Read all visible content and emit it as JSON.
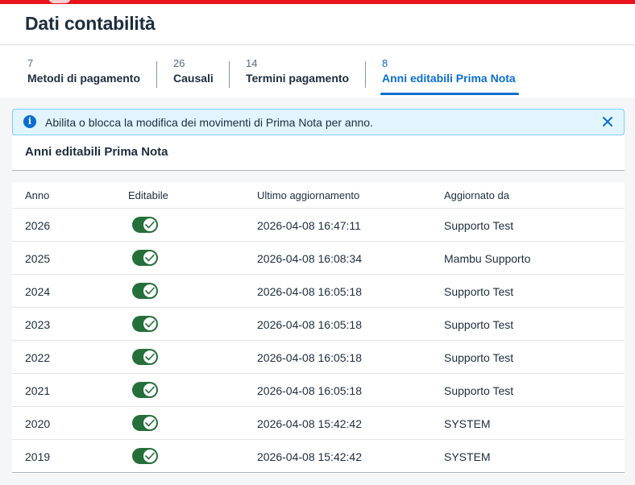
{
  "page": {
    "title": "Dati contabilità"
  },
  "tabs": [
    {
      "count": "7",
      "label": "Metodi di pagamento",
      "active": false
    },
    {
      "count": "26",
      "label": "Causali",
      "active": false
    },
    {
      "count": "14",
      "label": "Termini pagamento",
      "active": false
    },
    {
      "count": "8",
      "label": "Anni editabili Prima Nota",
      "active": true
    }
  ],
  "info_strip": {
    "text": "Abilita o blocca la modifica dei movimenti di Prima Nota per anno.",
    "icon": "info-icon"
  },
  "panel": {
    "title": "Anni editabili Prima Nota"
  },
  "table": {
    "headers": {
      "anno": "Anno",
      "editabile": "Editabile",
      "aggiornamento": "Ultimo aggiornamento",
      "aggiornato_da": "Aggiornato da"
    },
    "rows": [
      {
        "anno": "2026",
        "editable": true,
        "updated": "2026-04-08 16:47:11",
        "by": "Supporto Test"
      },
      {
        "anno": "2025",
        "editable": true,
        "updated": "2026-04-08 16:08:34",
        "by": "Mambu Supporto"
      },
      {
        "anno": "2024",
        "editable": true,
        "updated": "2026-04-08 16:05:18",
        "by": "Supporto Test"
      },
      {
        "anno": "2023",
        "editable": true,
        "updated": "2026-04-08 16:05:18",
        "by": "Supporto Test"
      },
      {
        "anno": "2022",
        "editable": true,
        "updated": "2026-04-08 16:05:18",
        "by": "Supporto Test"
      },
      {
        "anno": "2021",
        "editable": true,
        "updated": "2026-04-08 16:05:18",
        "by": "Supporto Test"
      },
      {
        "anno": "2020",
        "editable": true,
        "updated": "2026-04-08 15:42:42",
        "by": "SYSTEM"
      },
      {
        "anno": "2019",
        "editable": true,
        "updated": "2026-04-08 15:42:42",
        "by": "SYSTEM"
      }
    ]
  },
  "colors": {
    "accent": "#0a6ed1",
    "toggle_on": "#256f3a",
    "brand_strip": "#e8131b",
    "info_bg": "#e1f4ff"
  }
}
